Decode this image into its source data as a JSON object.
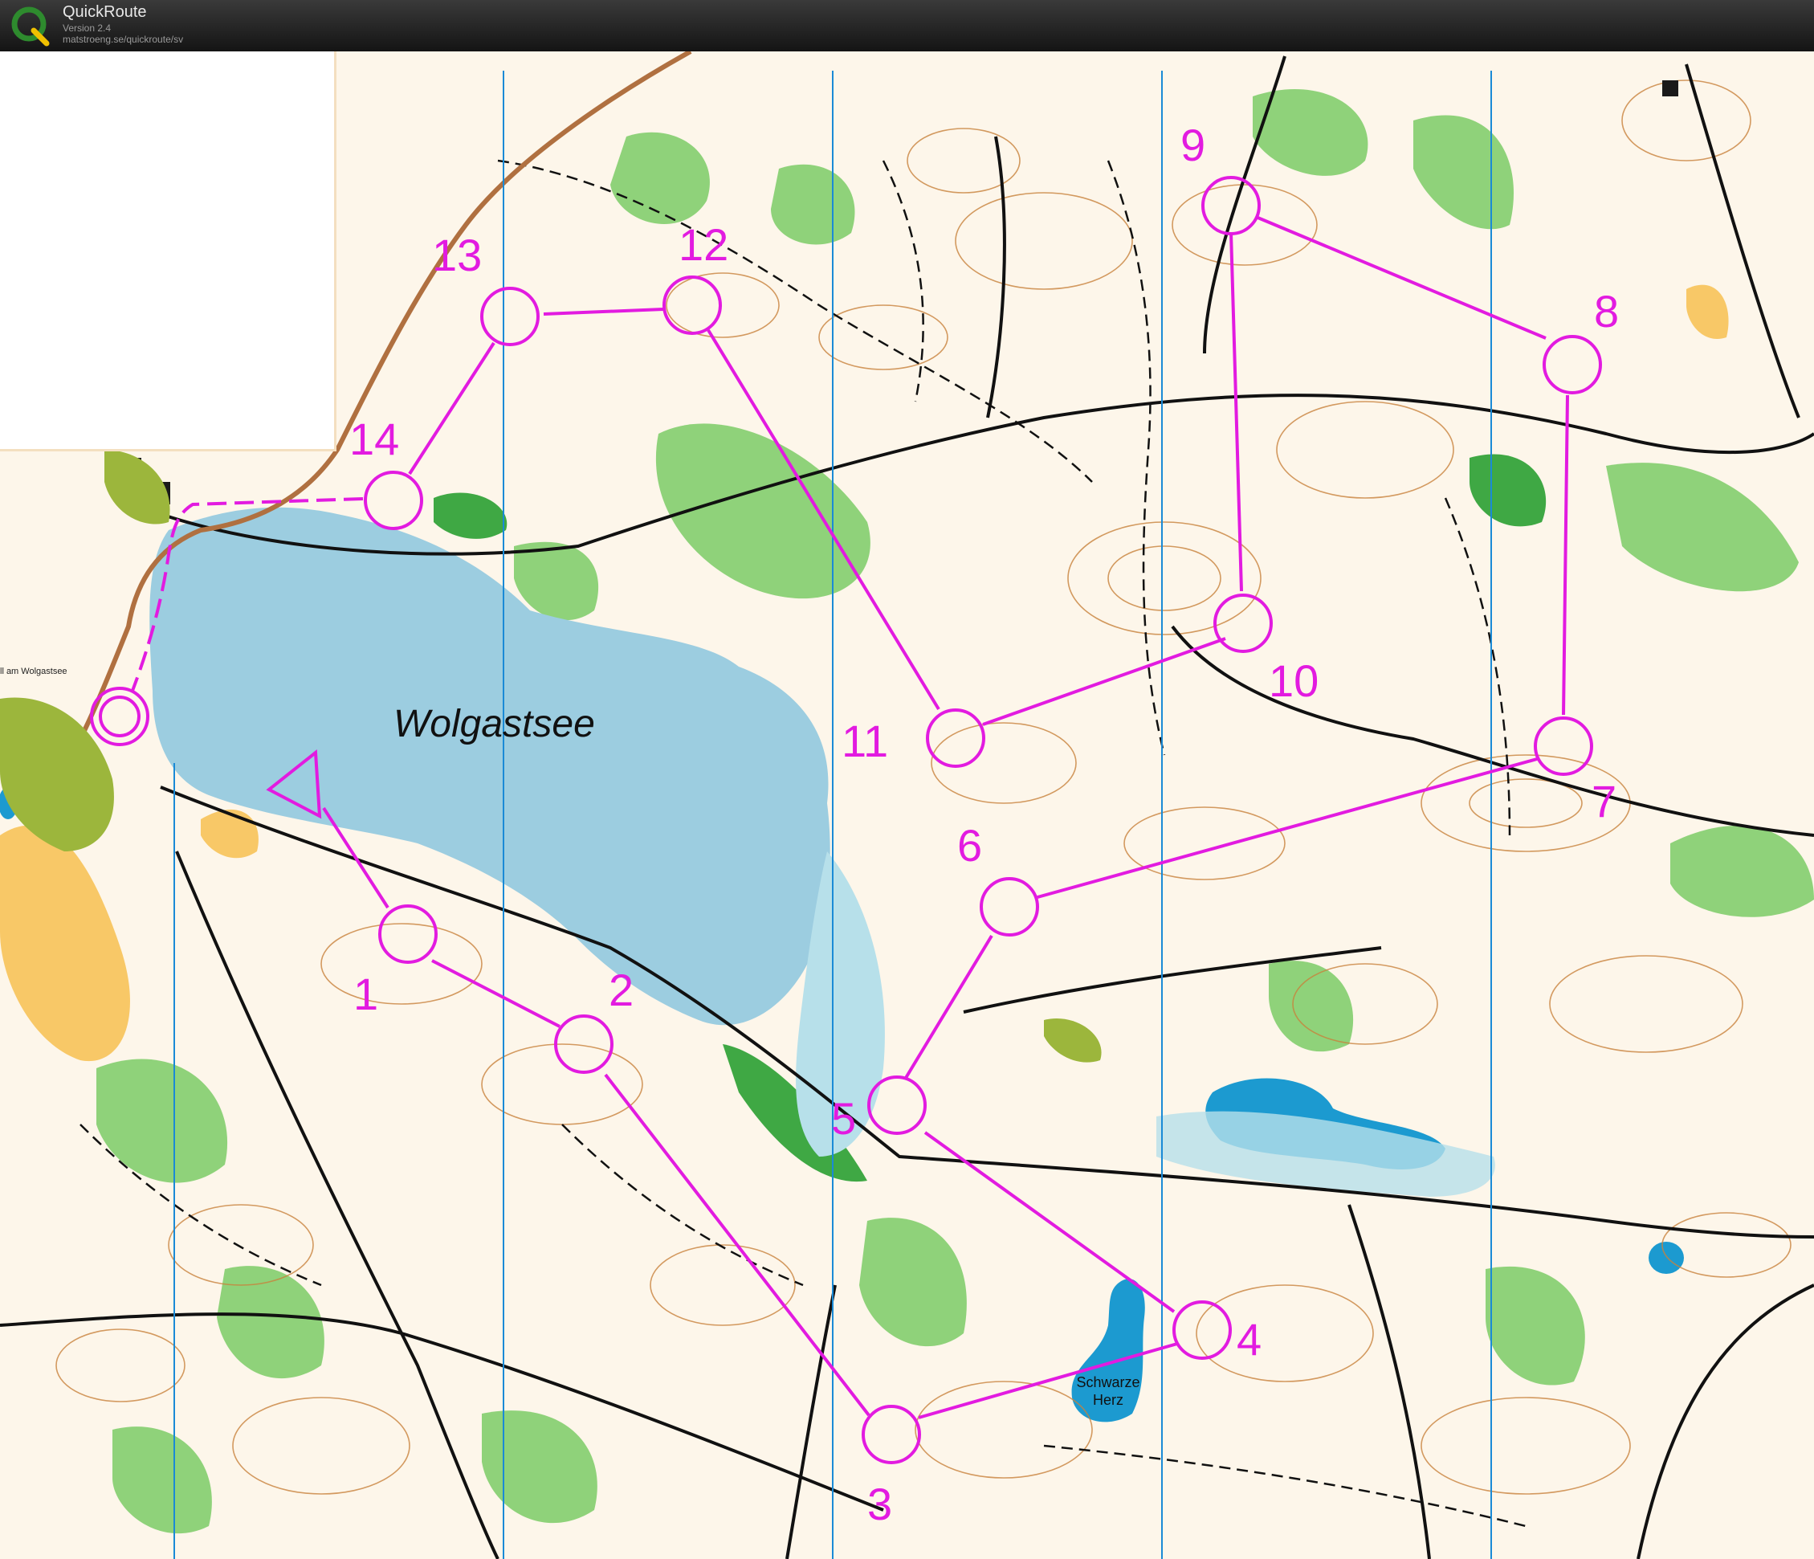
{
  "app": {
    "title": "QuickRoute",
    "version": "Version 2.4",
    "url": "matstroeng.se/quickroute/sv"
  },
  "map": {
    "lake_name": "Wolgastsee",
    "pond_name_line1": "Schwarze",
    "pond_name_line2": "Herz",
    "village_label": "ll am Wolgastsee",
    "course_color": "#e21be0",
    "water_color": "#9ccde0",
    "forest_color": "#7fc96b",
    "open_color": "#f6a800",
    "controls": [
      "1",
      "2",
      "3",
      "4",
      "5",
      "6",
      "7",
      "8",
      "9",
      "10",
      "11",
      "12",
      "13",
      "14"
    ]
  }
}
